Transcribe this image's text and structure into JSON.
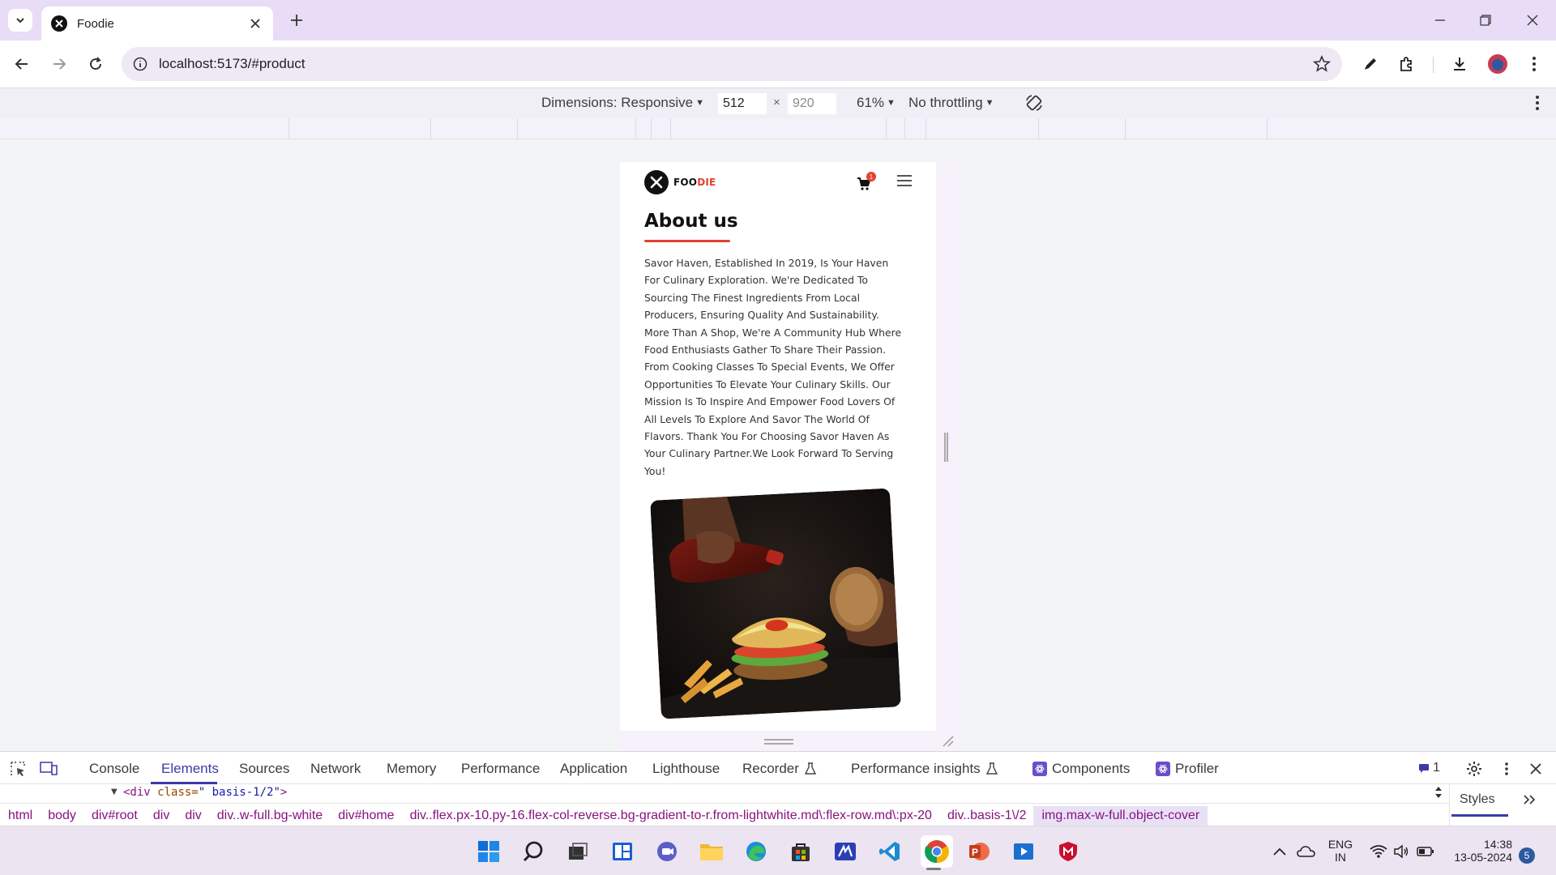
{
  "browser": {
    "tab_title": "Foodie",
    "url": "localhost:5173/#product"
  },
  "device_toolbar": {
    "dimensions_label": "Dimensions: Responsive",
    "width": "512",
    "height": "920",
    "zoom": "61%",
    "throttling": "No throttling"
  },
  "page": {
    "brand_part1": "FOO",
    "brand_part2": "DIE",
    "cart_count": "1",
    "heading": "About us",
    "about_text": "Savor Haven, Established In 2019, Is Your Haven For Culinary Exploration. We're Dedicated To Sourcing The Finest Ingredients From Local Producers, Ensuring Quality And Sustainability. More Than A Shop, We're A Community Hub Where Food Enthusiasts Gather To Share Their Passion. From Cooking Classes To Special Events, We Offer Opportunities To Elevate Your Culinary Skills. Our Mission Is To Inspire And Empower Food Lovers Of All Levels To Explore And Savor The World Of Flavors. Thank You For Choosing Savor Haven As Your Culinary Partner.We Look Forward To Serving You!"
  },
  "devtools": {
    "tabs": [
      "Console",
      "Elements",
      "Sources",
      "Network",
      "Memory",
      "Performance",
      "Application",
      "Lighthouse",
      "Recorder",
      "Performance insights",
      "Components",
      "Profiler"
    ],
    "active_tab": "Elements",
    "issues_count": "1",
    "dom_tag_open": "<div ",
    "dom_attr": "class=",
    "dom_value": "\" basis-1/2\"",
    "dom_tag_close": ">",
    "breadcrumbs": [
      "html",
      "body",
      "div#root",
      "div",
      "div",
      "div..w-full.bg-white",
      "div#home",
      "div..flex.px-10.py-16.flex-col-reverse.bg-gradient-to-r.from-lightwhite.md\\:flex-row.md\\:px-20",
      "div..basis-1\\/2",
      "img.max-w-full.object-cover"
    ],
    "styles_tab": "Styles"
  },
  "taskbar": {
    "lang_line1": "ENG",
    "lang_line2": "IN",
    "time": "14:38",
    "date": "13-05-2024",
    "notifications": "5"
  },
  "colors": {
    "accent_red": "#e5412f",
    "devtools_active": "#3b3aa8",
    "tabstrip": "#e9dcf7"
  },
  "icons": [
    "tab-search-icon",
    "close-icon",
    "plus-icon",
    "minimize-icon",
    "restore-icon",
    "back-arrow-icon",
    "forward-arrow-icon",
    "reload-icon",
    "site-info-icon",
    "star-icon",
    "pen-icon",
    "extensions-icon",
    "download-icon",
    "more-vert-icon",
    "rotate-icon",
    "cart-icon",
    "menu-icon",
    "inspect-icon",
    "device-toggle-icon",
    "gear-icon",
    "flask-icon",
    "react-icon",
    "windows-icon",
    "search-icon",
    "wifi-icon",
    "volume-icon",
    "battery-icon"
  ]
}
